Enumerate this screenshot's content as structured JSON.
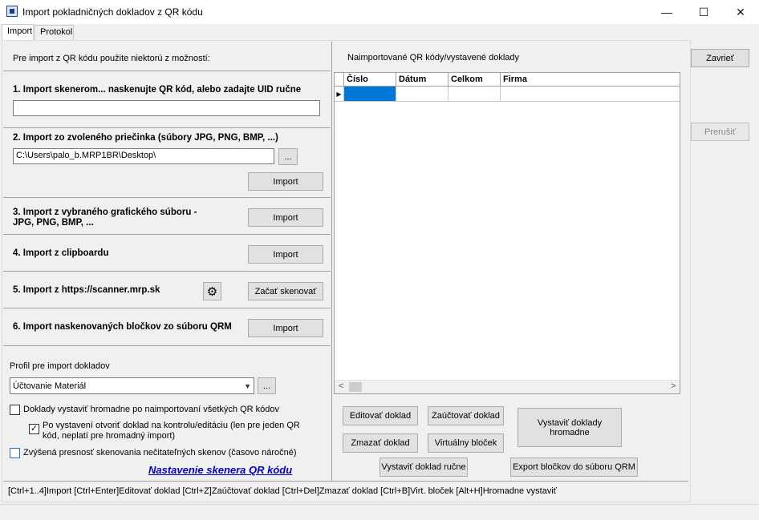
{
  "window": {
    "title": "Import pokladničných dokladov z QR kódu",
    "minimize": "—",
    "maximize": "☐",
    "close": "✕"
  },
  "tabs": [
    {
      "label": "Import"
    },
    {
      "label": "Protokol"
    }
  ],
  "left": {
    "intro": "Pre import z QR kódu použite niektorú z možností:",
    "s1": {
      "title": "1. Import skenerom... naskenujte QR kód, alebo zadajte UID ručne",
      "value": ""
    },
    "s2": {
      "title": "2. Import zo zvoleného priečinka (súbory JPG, PNG, BMP, ...)",
      "path": "C:\\Users\\palo_b.MRP1BR\\Desktop\\",
      "browse": "...",
      "import": "Import"
    },
    "s3": {
      "title_line1": "3. Import z vybraného grafického súboru -",
      "title_line2": "JPG, PNG, BMP, ...",
      "import": "Import"
    },
    "s4": {
      "title": "4. Import z clipboardu",
      "import": "Import"
    },
    "s5": {
      "title": "5. Import z https://scanner.mrp.sk",
      "start": "Začať skenovať"
    },
    "s6": {
      "title": "6. Import naskenovaných bločkov zo súboru QRM",
      "import": "Import"
    },
    "profile_label": "Profil pre import dokladov",
    "profile_value": "Účtovanie Materiál",
    "profile_browse": "...",
    "chk1": {
      "label": "Doklady vystaviť hromadne po naimportovaní všetkých QR kódov",
      "checked": false
    },
    "chk2": {
      "label_line1": "Po vystavení otvoriť doklad na kontrolu/editáciu (len pre jeden QR",
      "label_line2": "kód, neplatí pre hromadný import)",
      "checked": true
    },
    "chk3": {
      "label": "Zvýšená presnosť skenovania nečitateľných skenov (časovo náročné)",
      "checked": false
    },
    "link": "Nastavenie skenera QR kódu"
  },
  "right": {
    "heading": "Naimportované QR kódy/vystavené doklady",
    "columns": [
      "Číslo",
      "Dátum",
      "Celkom",
      "Firma"
    ],
    "buttons": {
      "edit": "Editovať doklad",
      "post": "Zaúčtovať doklad",
      "bulk_line1": "Vystaviť doklady",
      "bulk_line2": "hromadne",
      "delete": "Zmazať doklad",
      "virtual": "Virtuálny bloček",
      "manual": "Vystaviť doklad ručne",
      "export": "Export bločkov do súboru QRM"
    }
  },
  "side": {
    "close": "Zavrieť",
    "interrupt": "Prerušiť"
  },
  "shortcuts": "[Ctrl+1..4]Import  [Ctrl+Enter]Editovať doklad  [Ctrl+Z]Zaúčtovať doklad  [Ctrl+Del]Zmazať doklad  [Ctrl+B]Virt. bloček  [Alt+H]Hromadne vystaviť"
}
